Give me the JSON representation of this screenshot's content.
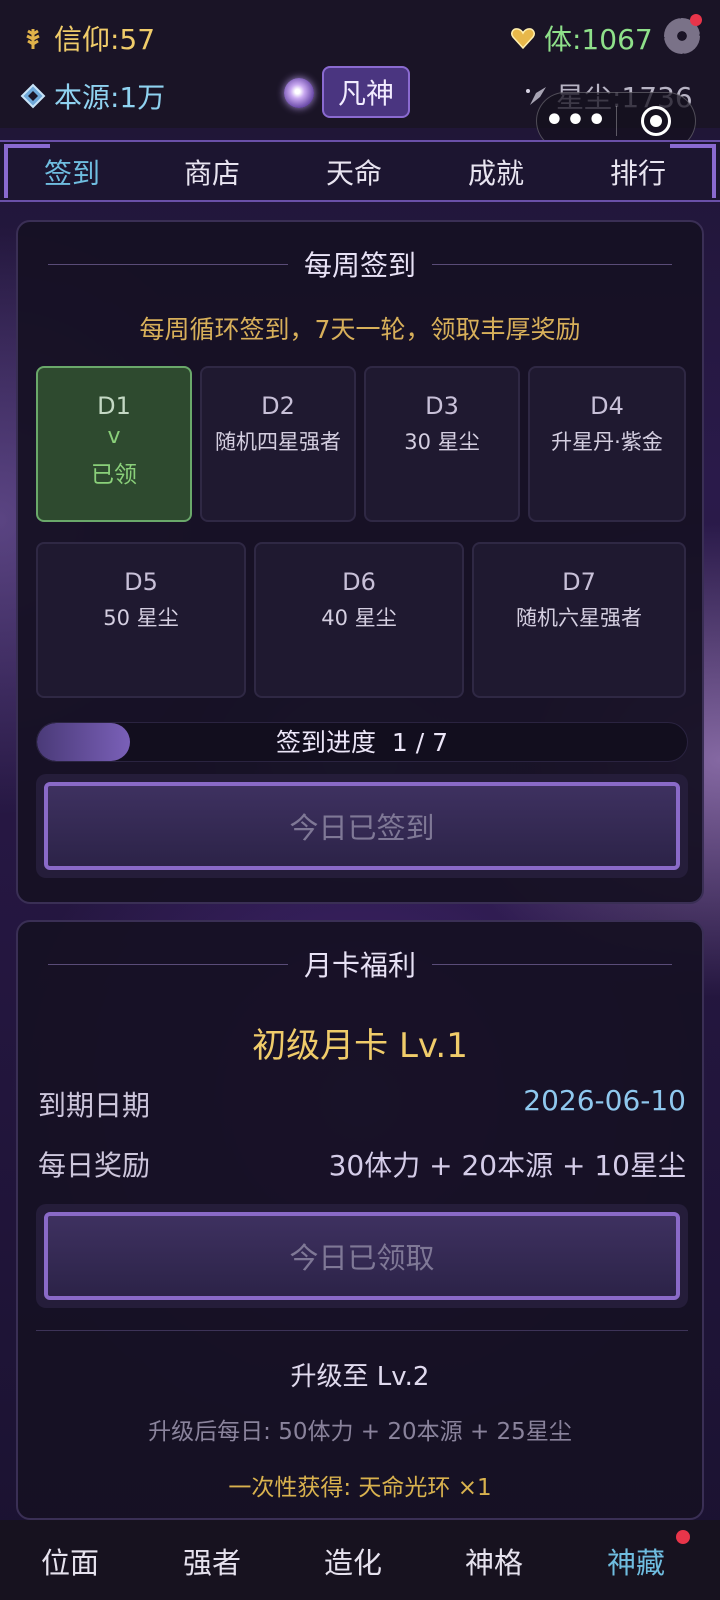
{
  "status": {
    "faith": "信仰:57",
    "stamina": "体:1067",
    "origin": "本源:1万",
    "rank": "凡神",
    "stardust": "星尘:1736"
  },
  "capsule": {
    "more": "•••"
  },
  "tabs": [
    "签到",
    "商店",
    "天命",
    "成就",
    "排行"
  ],
  "weekly": {
    "title": "每周签到",
    "hint": "每周循环签到，7天一轮，领取丰厚奖励",
    "days": [
      {
        "label": "D1",
        "reward": "v",
        "status": "已领"
      },
      {
        "label": "D2",
        "reward": "随机四星强者"
      },
      {
        "label": "D3",
        "reward": "30 星尘"
      },
      {
        "label": "D4",
        "reward": "升星丹·紫金"
      },
      {
        "label": "D5",
        "reward": "50 星尘"
      },
      {
        "label": "D6",
        "reward": "40 星尘"
      },
      {
        "label": "D7",
        "reward": "随机六星强者"
      }
    ],
    "progress_label": "签到进度",
    "progress_text": "1 / 7",
    "progress_fraction": 0.1429,
    "button": "今日已签到"
  },
  "monthly": {
    "title": "月卡福利",
    "card_name": "初级月卡 Lv.1",
    "expiry_label": "到期日期",
    "expiry_value": "2026-06-10",
    "daily_label": "每日奖励",
    "daily_value": "30体力 + 20本源 + 10星尘",
    "button": "今日已领取",
    "upgrade_title": "升级至 Lv.2",
    "upgrade_daily": "升级后每日: 50体力 + 20本源 + 25星尘",
    "upgrade_once": "一次性获得: 天命光环 ×1"
  },
  "bottom_nav": [
    "位面",
    "强者",
    "造化",
    "神格",
    "神藏"
  ],
  "colors": {
    "accent": "#6fbde0",
    "gold": "#f0cc6a",
    "badge_red": "#e8354a"
  }
}
